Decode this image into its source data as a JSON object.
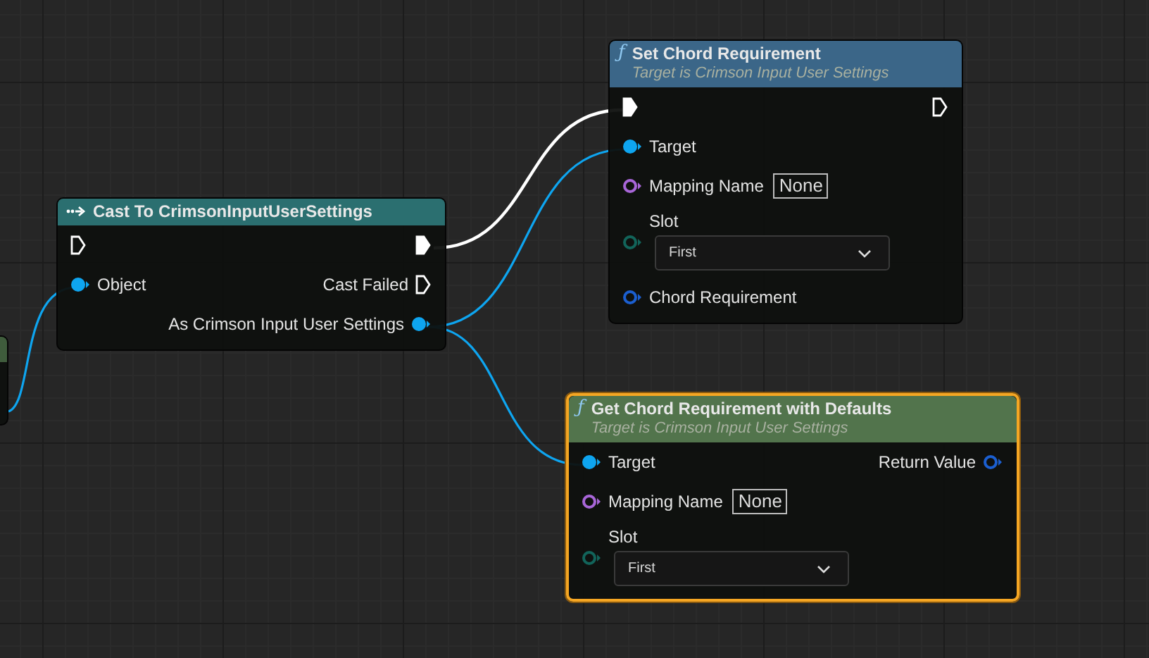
{
  "nodes": [
    {
      "kind": "clipped",
      "color": "#3f5c3c",
      "selected": false
    },
    {
      "kind": "cast",
      "title": "Cast To CrimsonInputUserSettings",
      "color": "#2b6f70",
      "selected": false,
      "rows": [
        {
          "left": {
            "kind": "exec",
            "connected": false
          },
          "right": {
            "kind": "exec",
            "connected": true
          }
        },
        {
          "left": {
            "kind": "data",
            "label": "Object",
            "connected": true,
            "color": "#0ea5f0"
          },
          "right": {
            "kind": "exec",
            "label": "Cast Failed",
            "connected": false
          }
        },
        {
          "right": {
            "kind": "data",
            "label": "As Crimson Input User Settings",
            "connected": true,
            "color": "#0ea5f0"
          }
        }
      ]
    },
    {
      "kind": "function",
      "icon": "ƒ",
      "title": "Set Chord Requirement",
      "subtitle": "Target is Crimson Input User Settings",
      "color": "#3b6688",
      "selected": false,
      "rows": [
        {
          "left": {
            "kind": "exec",
            "connected": true
          },
          "right": {
            "kind": "exec",
            "connected": false
          }
        },
        {
          "left": {
            "kind": "data",
            "label": "Target",
            "connected": true,
            "color": "#0ea5f0"
          }
        },
        {
          "left": {
            "kind": "data",
            "label": "Mapping Name",
            "connected": false,
            "color": "#a866d8",
            "field": {
              "kind": "text",
              "value": "None"
            }
          }
        },
        {
          "left": {
            "kind": "data",
            "label": "Slot",
            "connected": false,
            "color": "#12645a",
            "field": {
              "kind": "dropdown",
              "value": "First"
            }
          }
        },
        {
          "left": {
            "kind": "data",
            "label": "Chord Requirement",
            "connected": false,
            "color": "#1b5fd0"
          }
        }
      ]
    },
    {
      "kind": "function",
      "icon": "ƒ",
      "title": "Get Chord Requirement with Defaults",
      "subtitle": "Target is Crimson Input User Settings",
      "color": "#52744c",
      "selected": true,
      "rows": [
        {
          "left": {
            "kind": "data",
            "label": "Target",
            "connected": true,
            "color": "#0ea5f0"
          },
          "right": {
            "kind": "data",
            "label": "Return Value",
            "connected": false,
            "color": "#1b5fd0"
          }
        },
        {
          "left": {
            "kind": "data",
            "label": "Mapping Name",
            "connected": false,
            "color": "#a866d8",
            "field": {
              "kind": "text",
              "value": "None"
            }
          }
        },
        {
          "left": {
            "kind": "data",
            "label": "Slot",
            "connected": false,
            "color": "#12645a",
            "field": {
              "kind": "dropdown",
              "value": "First"
            }
          }
        }
      ]
    }
  ]
}
